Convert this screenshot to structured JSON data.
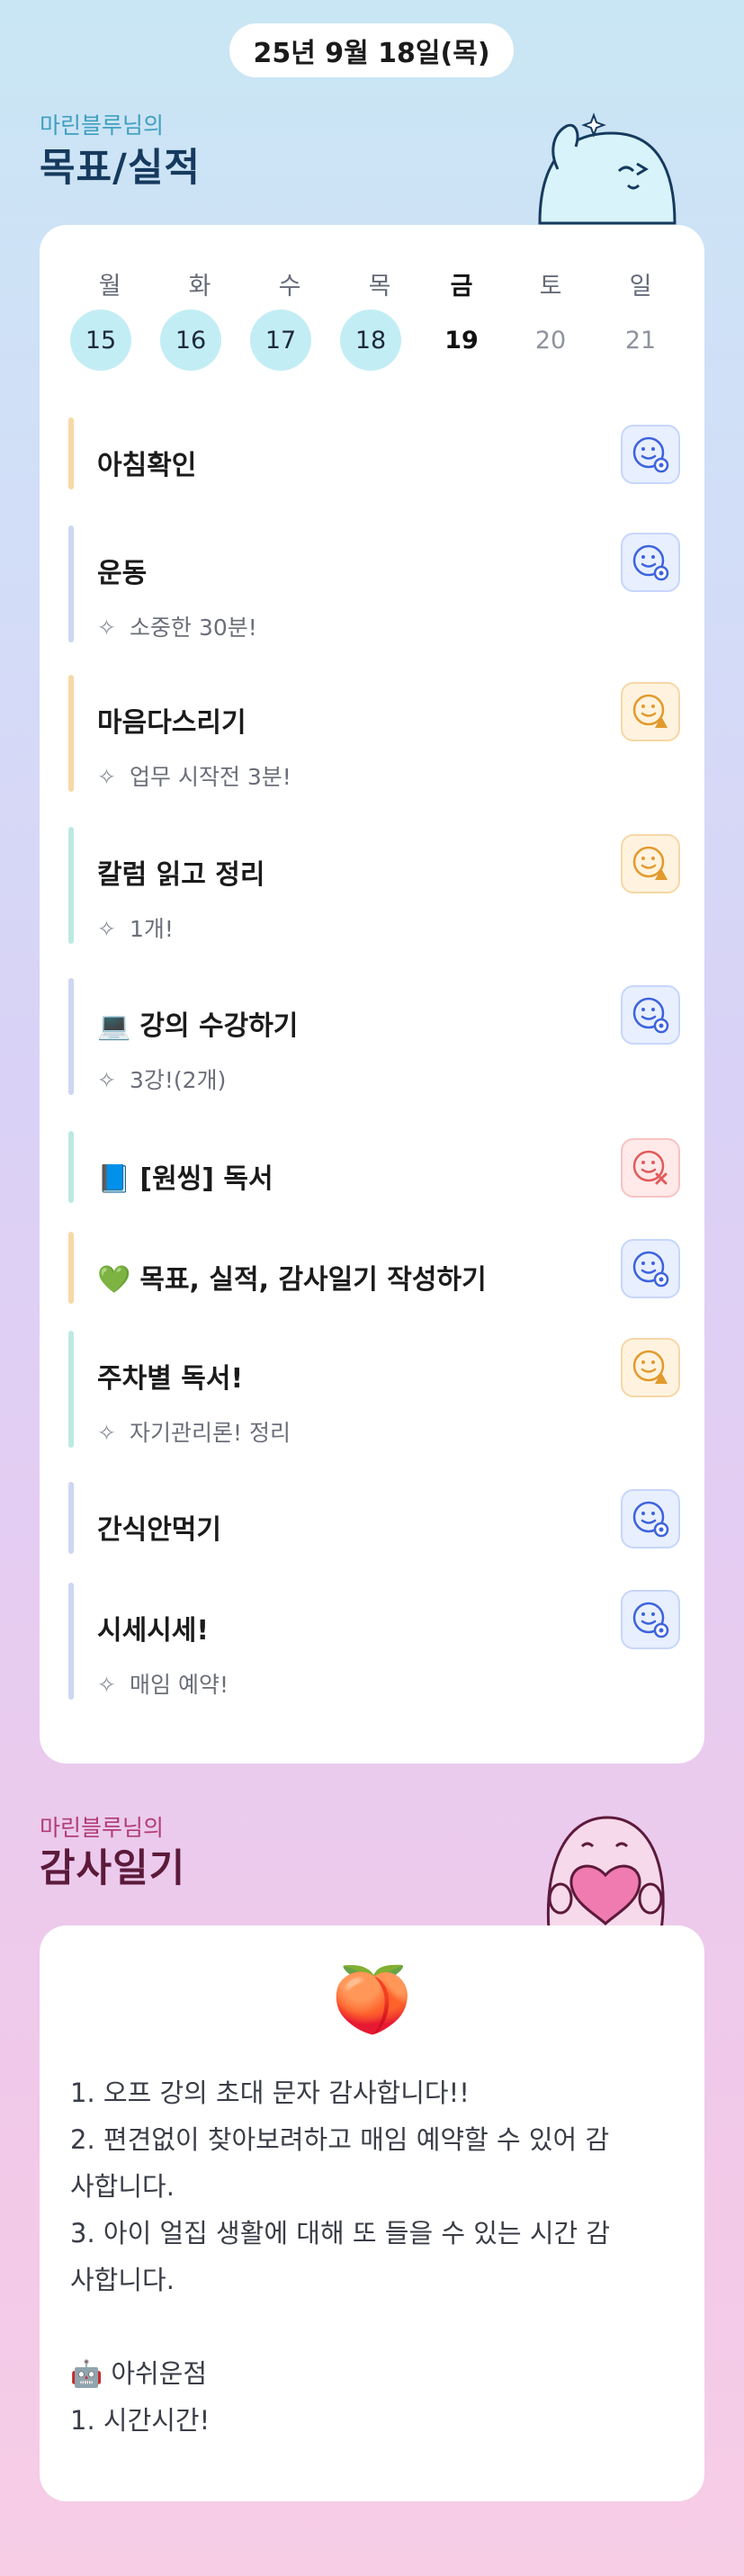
{
  "header": {
    "date": "25년 9월 18일(목)"
  },
  "goals_section": {
    "subtitle": "마린블루님의",
    "title": "목표/실적"
  },
  "week": {
    "days": [
      "월",
      "화",
      "수",
      "목",
      "금",
      "토",
      "일"
    ],
    "dates": [
      "15",
      "16",
      "17",
      "18",
      "19",
      "20",
      "21"
    ],
    "done_days": [
      0,
      1,
      2,
      3
    ],
    "today_index": 4
  },
  "tasks": [
    {
      "title": "아침확인",
      "bar_color": "#f6d9a6",
      "status": "ok"
    },
    {
      "title": "운동",
      "sub": "소중한 30분!",
      "bar_color": "#cdd6f3",
      "status": "ok"
    },
    {
      "title": "마음다스리기",
      "sub": "업무 시작전 3분!",
      "bar_color": "#f6d9a6",
      "status": "warn"
    },
    {
      "title": "칼럼 읽고 정리",
      "sub": "1개!",
      "bar_color": "#bde9e3",
      "status": "warn"
    },
    {
      "emoji": "💻",
      "title": "강의 수강하기",
      "sub": "3강!(2개)",
      "bar_color": "#cdd6f3",
      "status": "ok"
    },
    {
      "emoji": "📘",
      "title": "[원씽] 독서",
      "bar_color": "#bde9e3",
      "status": "bad"
    },
    {
      "emoji": "💚",
      "title": "목표, 실적, 감사일기 작성하기",
      "bar_color": "#f6d9a6",
      "status": "ok"
    },
    {
      "title": "주차별 독서!",
      "sub": "자기관리론! 정리",
      "bar_color": "#bde9e3",
      "status": "warn"
    },
    {
      "title": "간식안먹기",
      "bar_color": "#cdd6f3",
      "status": "ok"
    },
    {
      "title": "시세시세!",
      "sub": "매임 예약!",
      "bar_color": "#cdd6f3",
      "status": "ok"
    }
  ],
  "journal_section": {
    "subtitle": "마린블루님의",
    "title": "감사일기"
  },
  "journal": {
    "emoji": "🍑",
    "lines": [
      "1. 오프 강의 초대 문자 감사합니다!!",
      "2. 편견없이 찾아보려하고 매임 예약할 수 있어 감",
      "사합니다.",
      "3. 아이 얼집 생활에 대해 또 들을 수 있는 시간 감",
      "사합니다.",
      "",
      "🤖 아쉬운점",
      "1. 시간시간!"
    ]
  },
  "icons": {
    "spark": "sparkle-outline-icon",
    "status_ok": "smile-check-icon",
    "status_warn": "smile-triangle-icon",
    "status_bad": "face-x-icon"
  },
  "colors": {
    "ok": "#3d63dd",
    "warn": "#e39a2d",
    "bad": "#e25b5b",
    "done_day": "#c3edf4"
  }
}
